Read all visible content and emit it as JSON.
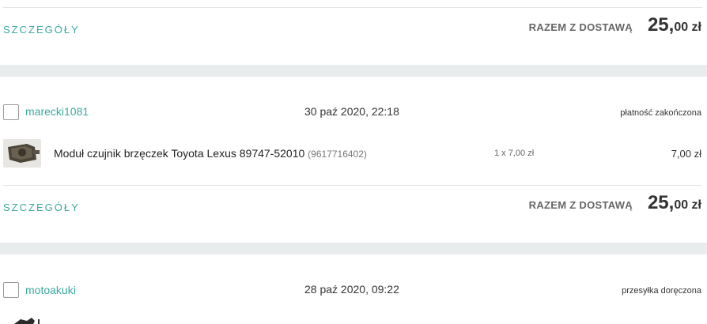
{
  "orders": [
    {
      "details_label": "SZCZEGÓŁY",
      "total_label": "RAZEM Z DOSTAWĄ",
      "total_main": "25,",
      "total_cents": "00 zł"
    },
    {
      "seller": "marecki1081",
      "date": "30 paź 2020, 22:18",
      "status": "płatność zakończona",
      "item": {
        "title": "Moduł czujnik brzęczek Toyota Lexus 89747-52010",
        "offer_id": "(9617716402)",
        "quantity": "1 x 7,00 zł",
        "price": "7,00 zł"
      },
      "details_label": "SZCZEGÓŁY",
      "total_label": "RAZEM Z DOSTAWĄ",
      "total_main": "25,",
      "total_cents": "00 zł"
    },
    {
      "seller": "motoakuki",
      "date": "28 paź 2020, 09:22",
      "status": "przesyłka doręczona"
    }
  ],
  "icons": {
    "checkbox": "checkbox-icon",
    "thumbnail": "product-thumbnail"
  }
}
